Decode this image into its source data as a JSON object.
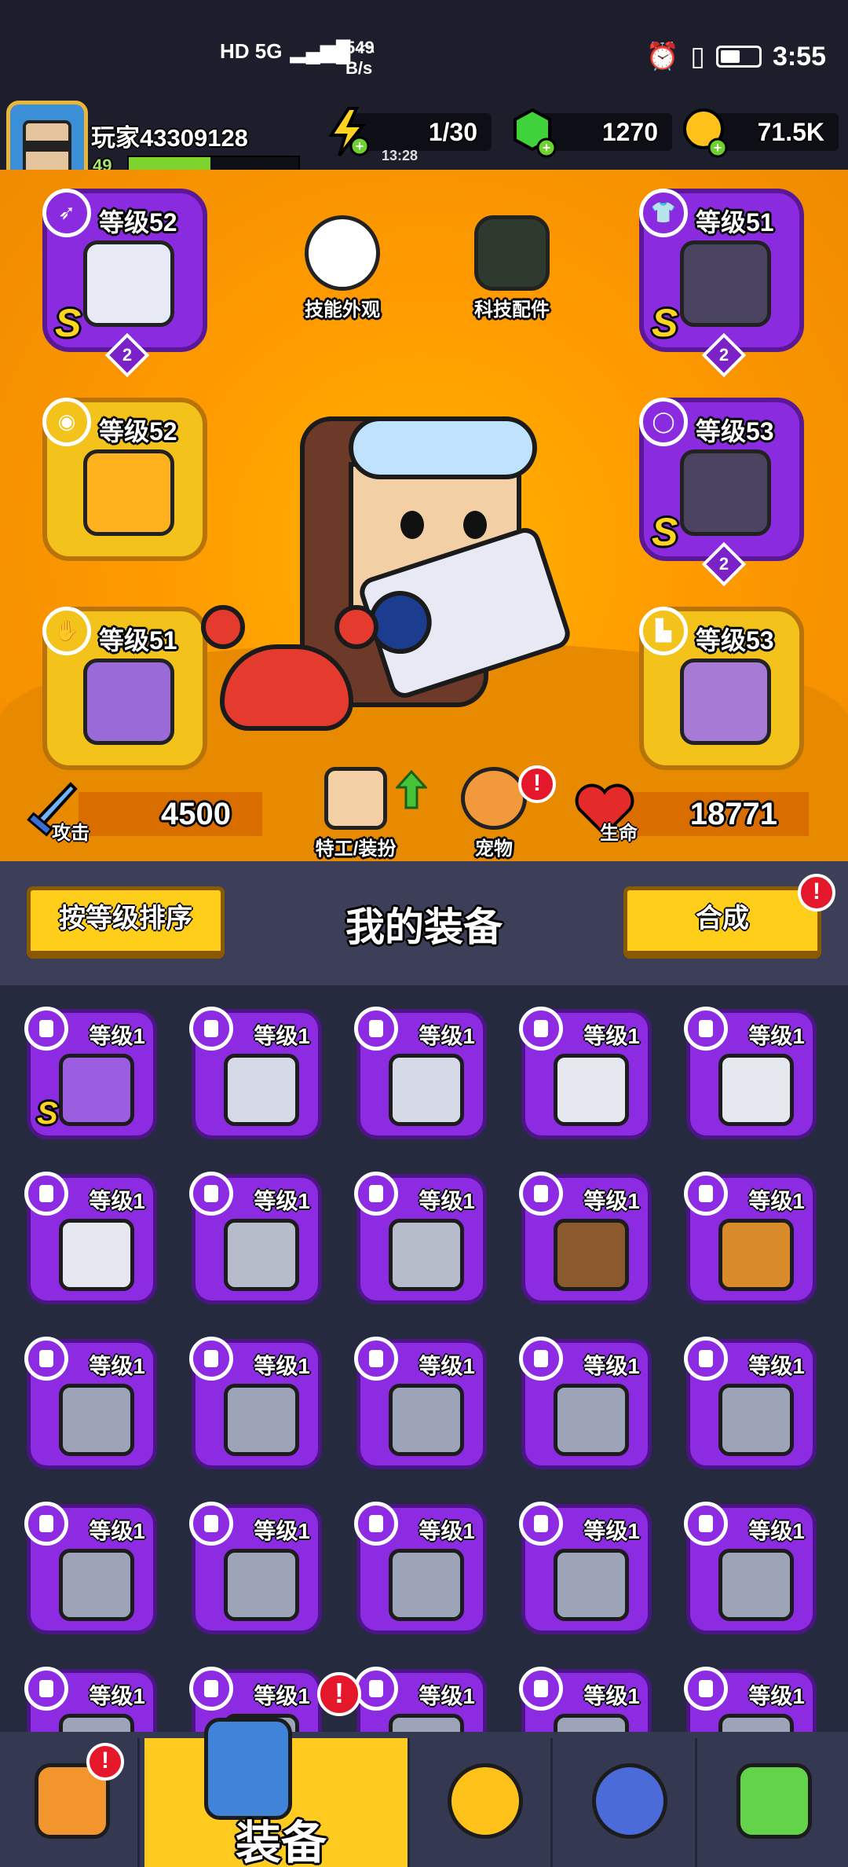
{
  "status_bar": {
    "network": "HD 5G",
    "speed": "549",
    "speed_unit": "B/s",
    "time": "3:55"
  },
  "player": {
    "name": "玩家43309128",
    "level": "49",
    "xp_fraction": 0.48
  },
  "resources": {
    "energy": "1/30",
    "energy_timer": "13:28",
    "gems": "1270",
    "coins": "71.5K"
  },
  "equipped": {
    "weapon": {
      "level_label": "等级52",
      "rank": "S",
      "stars": "2",
      "icon": "gun-icon"
    },
    "armor": {
      "level_label": "等级51",
      "rank": "S",
      "stars": "2",
      "icon": "armor-icon"
    },
    "necklace": {
      "level_label": "等级52",
      "icon": "necklace-icon"
    },
    "belt": {
      "level_label": "等级53",
      "rank": "S",
      "stars": "2",
      "icon": "belt-icon"
    },
    "gloves": {
      "level_label": "等级51",
      "icon": "glove-icon"
    },
    "boots": {
      "level_label": "等级53",
      "icon": "boot-icon"
    }
  },
  "hero_buttons": {
    "skill_skin": "技能外观",
    "tech_parts": "科技配件",
    "agent_outfit": "特工/装扮",
    "pet": "宠物"
  },
  "stats": {
    "attack_label": "攻击",
    "attack": "4500",
    "hp_label": "生命",
    "hp": "18771"
  },
  "actions": {
    "sort": "按等级排序",
    "title": "我的装备",
    "merge": "合成",
    "merge_alert": "!"
  },
  "inventory": {
    "rows": [
      [
        {
          "lvl": "等级1",
          "icon": "glove-icon",
          "rank": "S"
        },
        {
          "lvl": "等级1",
          "icon": "kunai-icon"
        },
        {
          "lvl": "等级1",
          "icon": "kunai-icon"
        },
        {
          "lvl": "等级1",
          "icon": "saber-icon"
        },
        {
          "lvl": "等级1",
          "icon": "saber-icon"
        }
      ],
      [
        {
          "lvl": "等级1",
          "icon": "saber-icon"
        },
        {
          "lvl": "等级1",
          "icon": "revolver-icon"
        },
        {
          "lvl": "等级1",
          "icon": "revolver-icon"
        },
        {
          "lvl": "等级1",
          "icon": "shotgun-icon"
        },
        {
          "lvl": "等级1",
          "icon": "torch-icon"
        }
      ],
      [
        {
          "lvl": "等级1",
          "icon": "armor-icon"
        },
        {
          "lvl": "等级1",
          "icon": "armor-icon"
        },
        {
          "lvl": "等级1",
          "icon": "armor-icon"
        },
        {
          "lvl": "等级1",
          "icon": "armor-icon"
        },
        {
          "lvl": "等级1",
          "icon": "armor-icon"
        }
      ],
      [
        {
          "lvl": "等级1",
          "icon": "armor-icon"
        },
        {
          "lvl": "等级1",
          "icon": "armor-icon"
        },
        {
          "lvl": "等级1",
          "icon": "armor-icon"
        },
        {
          "lvl": "等级1",
          "icon": "armor-icon"
        },
        {
          "lvl": "等级1",
          "icon": "armor-icon"
        }
      ],
      [
        {
          "lvl": "等级1",
          "icon": "armor-icon"
        },
        {
          "lvl": "等级1",
          "icon": "armor-icon"
        },
        {
          "lvl": "等级1",
          "icon": "armor-icon"
        },
        {
          "lvl": "等级1",
          "icon": "armor-icon"
        },
        {
          "lvl": "等级1",
          "icon": "armor-icon"
        }
      ]
    ]
  },
  "nav": {
    "shop_alert": "!",
    "equip_label": "装备",
    "equip_alert": "!",
    "tabs": [
      "shop-icon",
      "equipment-icon",
      "star-icon",
      "orb-icon",
      "dna-icon"
    ]
  },
  "colors": {
    "orange": "#ff9b00",
    "purple": "#8d2be3",
    "yellow": "#ffce1a",
    "alert": "#e5172b"
  }
}
